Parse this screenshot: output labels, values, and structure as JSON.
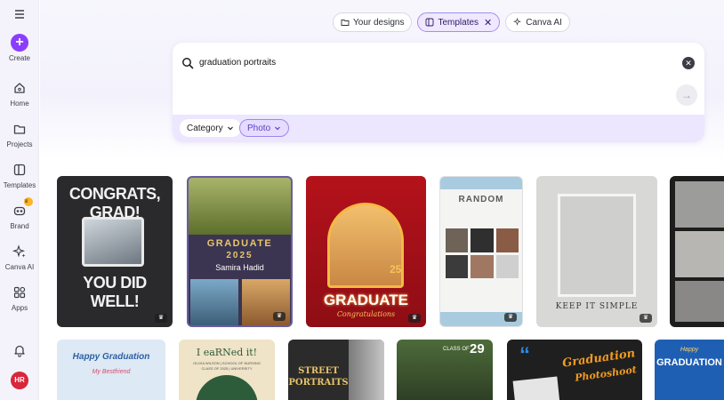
{
  "sidebar": {
    "menu_icon": "hamburger-icon",
    "items": [
      {
        "label": "Create",
        "icon": "plus-icon"
      },
      {
        "label": "Home",
        "icon": "home-icon"
      },
      {
        "label": "Projects",
        "icon": "folder-icon"
      },
      {
        "label": "Templates",
        "icon": "templates-icon"
      },
      {
        "label": "Brand",
        "icon": "brand-icon"
      },
      {
        "label": "Canva AI",
        "icon": "sparkle-icon"
      },
      {
        "label": "Apps",
        "icon": "apps-icon"
      }
    ],
    "avatar_initials": "HR"
  },
  "top_pills": {
    "your_designs": "Your designs",
    "templates": "Templates",
    "canva_ai": "Canva AI"
  },
  "search": {
    "query": "graduation portraits",
    "filters": {
      "category": "Category",
      "photo": "Photo"
    }
  },
  "templates": [
    {
      "line1": "CONGRATS, GRAD!",
      "line2": "YOU DID WELL!"
    },
    {
      "line1": "GRADUATE",
      "line2": "2025",
      "line3": "Samira Hadid"
    },
    {
      "line1": "GRADUATE",
      "line2": "Congratulations",
      "year": "25"
    },
    {
      "line1": "RANDOM"
    },
    {
      "line1": "KEEP IT SIMPLE"
    },
    {
      "line1": ""
    },
    {
      "line1": "Happy Graduation",
      "line2": "My Bestfriend"
    },
    {
      "line1": "I eaRNed it!",
      "line2": "OLIVIA WILSON | SCHOOL OF NURSING",
      "line3": "CLASS OF 2025 | UNIVERSITY"
    },
    {
      "line1": "STREET",
      "line2": "PORTRAITS"
    },
    {
      "line1": "CLASS OF",
      "line2": "29"
    },
    {
      "line1": "Graduation",
      "line2": "Photoshoot"
    },
    {
      "line1": "Happy",
      "line2": "GRADUATION"
    }
  ],
  "colors": {
    "accent": "#8b3dff",
    "avatar": "#d8263a",
    "filter_bar": "#ede6ff"
  }
}
